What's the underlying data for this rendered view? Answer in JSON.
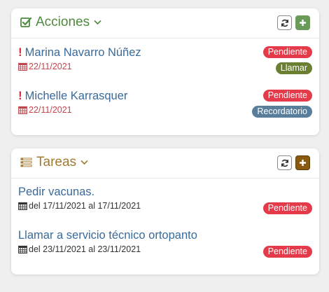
{
  "acciones": {
    "title": "Acciones",
    "items": [
      {
        "name": "Marina Navarro Núñez",
        "date": "22/11/2021",
        "status": "Pendiente",
        "type": "Llamar"
      },
      {
        "name": "Michelle Karrasquer",
        "date": "22/11/2021",
        "status": "Pendiente",
        "type": "Recordatorio"
      }
    ]
  },
  "tareas": {
    "title": "Tareas",
    "items": [
      {
        "name": "Pedir vacunas.",
        "range": "del 17/11/2021 al 17/11/2021",
        "status": "Pendiente"
      },
      {
        "name": "Llamar a servicio técnico ortopanto",
        "range": "del 23/11/2021 al 23/11/2021",
        "status": "Pendiente"
      }
    ]
  },
  "icons": {
    "acciones_title": "checkbox-icon",
    "tareas_title": "list-icon",
    "refresh": "refresh-icon",
    "add": "plus-icon",
    "calendar": "calendar-icon",
    "alert": "exclamation-icon",
    "collapse": "chevron-down-icon"
  },
  "colors": {
    "acciones_accent": "#4e8a3f",
    "tareas_accent": "#a07a2e",
    "link": "#3a6a9a",
    "pendiente": "#e53a4a",
    "llamar": "#6b7f33",
    "recordatorio": "#587e9c",
    "add_green": "#6a9a58",
    "add_brown": "#8a5a10"
  }
}
